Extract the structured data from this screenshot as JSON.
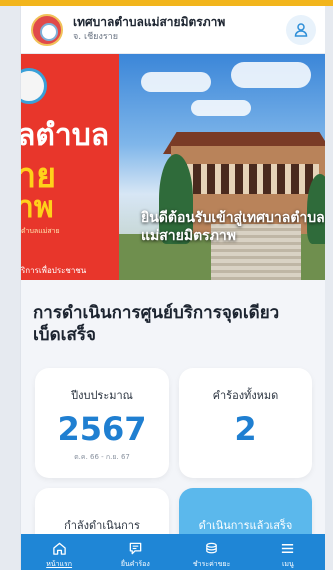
{
  "header": {
    "title": "เทศบาลตำบลแม่สายมิตรภาพ",
    "subtitle": "จ. เชียงราย",
    "user_icon": "user-icon"
  },
  "banner": {
    "big_line1": "ลตำบล",
    "big_line2": "าย",
    "big_line3": "าพ",
    "small_text": "ตำบลแม่สาย",
    "service_text": "ริการเพื่อประชาชน",
    "welcome_line1": "ยินดีต้อนรับเข้าสู่เทศบาลตำบล",
    "welcome_line2": "แม่สายมิตรภาพ"
  },
  "section": {
    "title": "การดำเนินการศูนย์บริการจุดเดียวเบ็ดเสร็จ"
  },
  "cards": {
    "fiscal": {
      "label": "ปีงบประมาณ",
      "value": "2567",
      "note": "ต.ค. 66 - ก.ย. 67"
    },
    "requests": {
      "label": "คำร้องทั้งหมด",
      "value": "2"
    },
    "in_progress": {
      "label": "กำลังดำเนินการ"
    },
    "done": {
      "label": "ดำเนินการแล้วเสร็จ"
    }
  },
  "bottom_nav": {
    "items": [
      {
        "label": "หน้าแรก",
        "icon": "home-icon"
      },
      {
        "label": "ยื่นคำร้อง",
        "icon": "chat-icon"
      },
      {
        "label": "ชำระค่าขยะ",
        "icon": "coins-icon"
      },
      {
        "label": "เมนู",
        "icon": "menu-icon"
      }
    ]
  },
  "colors": {
    "accent": "#1f86d6",
    "value_blue": "#1f7fd1",
    "banner_red": "#e8362b",
    "banner_yellow": "#ffd11a",
    "done_card": "#5bb8ec"
  }
}
